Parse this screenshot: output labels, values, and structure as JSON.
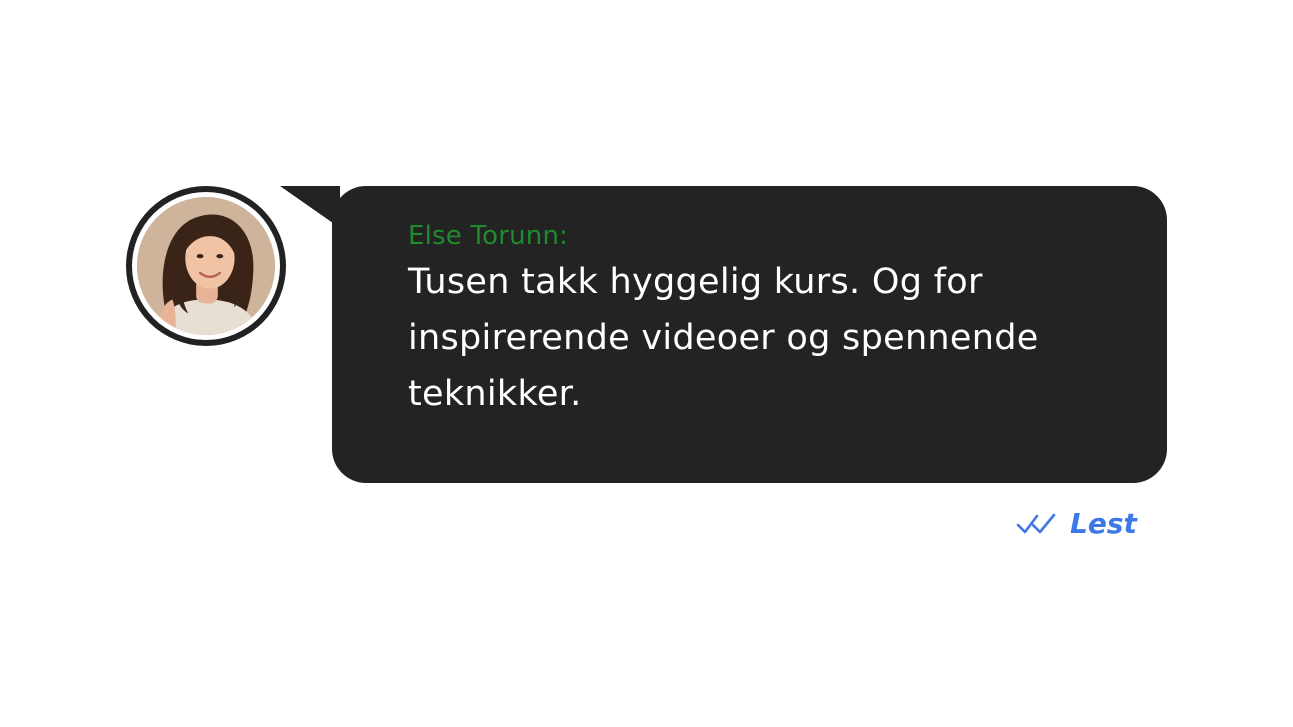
{
  "message": {
    "sender": "Else Torunn:",
    "text": "Tusen takk hyggelig kurs. Og for inspirerende videoer og spennende teknikker.",
    "status_label": "Lest",
    "status_icon": "double-check-icon"
  },
  "avatar": {
    "icon": "avatar-photo"
  },
  "colors": {
    "bubble": "#232323",
    "sender": "#1f8a2e",
    "message_text": "#ffffff",
    "status": "#3d78e6",
    "avatar_ring": "#222222"
  }
}
